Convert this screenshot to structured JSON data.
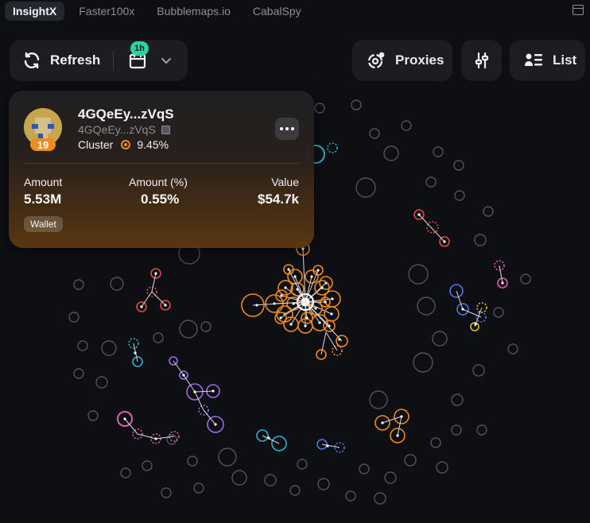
{
  "tabs": [
    {
      "label": "InsightX",
      "active": true
    },
    {
      "label": "Faster100x",
      "active": false
    },
    {
      "label": "Bubblemaps.io",
      "active": false
    },
    {
      "label": "CabalSpy",
      "active": false
    }
  ],
  "toolbar": {
    "refresh_label": "Refresh",
    "time_badge": "1h",
    "proxies_label": "Proxies",
    "list_label": "List"
  },
  "holder": {
    "address": "4GQeEy...zVqS",
    "address_sub": "4GQeEy...zVqS",
    "rank": "19",
    "cluster_label": "Cluster",
    "cluster_percent": "9.45%",
    "amount_label": "Amount",
    "amount_value": "5.53M",
    "amount_pct_label": "Amount (%)",
    "amount_pct_value": "0.55%",
    "value_label": "Value",
    "value_value": "$54.7k",
    "tag": "Wallet"
  },
  "colors": {
    "orange": "#f08a1c",
    "cyan": "#2ab3d6",
    "red": "#e04848",
    "purple": "#9b6cf0",
    "magenta": "#e458b8",
    "blue": "#4a78e6",
    "yellow": "#e0c02a",
    "gray": "#50525b"
  }
}
